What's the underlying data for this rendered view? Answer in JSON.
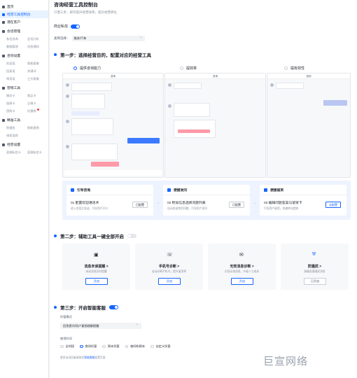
{
  "sidebar": {
    "home": "首页",
    "active_item": "经营工具控制台",
    "customers": "潜在客户",
    "conversation_mgmt": {
      "label": "会话管理",
      "subs": [
        "私信咨询",
        "会话分析",
        "客服管理",
        "消息通知"
      ]
    },
    "consult_settings": {
      "label": "咨询设置",
      "subs": [
        "欢迎语",
        "智能客服",
        "回复语",
        "关键词",
        "常用语",
        "三方客服"
      ]
    },
    "marketing_tools": {
      "label": "营销工具",
      "subs": [
        "服务卡",
        "商品卡",
        "链接卡",
        "企微卡",
        "团购卡",
        "优惠券"
      ]
    },
    "precise_tools": {
      "label": "精准工具",
      "subs": [
        "防骚扰",
        "智能意图",
        "线索追踪"
      ]
    },
    "account": {
      "label": "经营设置",
      "subs": [
        "蓝微私信卡",
        "蓝微私信卡"
      ]
    }
  },
  "header": {
    "title": "咨询经营工具控制台",
    "subtitle": "只需三步，即可提升经营效率，提升经营转化"
  },
  "private_msg": {
    "label": "商业私信",
    "toggle_on": true
  },
  "industry": {
    "label": "类目选择：",
    "value": "服务/汽车"
  },
  "step1": {
    "title": "第一步：选择经营目的，配置对应的经营工具",
    "options": [
      "提供咨询能力",
      "提效率",
      "提有效性"
    ],
    "phone_header": "咨询"
  },
  "flow": {
    "cards": [
      {
        "head": "引导咨询",
        "title": "01 配置欢迎语话术",
        "desc": "进入会话后发送，引导用户开口",
        "btn": "已配置"
      },
      {
        "head": "便捷发问",
        "title": "02 附加信息选择问题列表",
        "desc": "自动发送常用问题，引导用户发问",
        "btn": "已配置"
      },
      {
        "head": "便捷留资",
        "title": "03 编辑问题答案与留资卡",
        "desc": "引导用户留资，快速转化提效",
        "btn": "去配置"
      }
    ]
  },
  "step2": {
    "title": "第二步：辅助工具一键全部开启",
    "toggle_on": false,
    "tools": [
      {
        "icon": "message-icon",
        "title": "消息未读提醒 >",
        "desc": "未读消息及时提醒",
        "btn": "开启"
      },
      {
        "icon": "phone-icon",
        "title": "手机号诊断 >",
        "desc": "自动诊断手机号，提升留资率",
        "btn": "开启"
      },
      {
        "icon": "diagnosis-icon",
        "title": "无效消息诊断 >",
        "desc": "识别无效消息，节省人力成本",
        "btn": "开启"
      },
      {
        "icon": "shield-icon",
        "title": "防骚扰 >",
        "desc": "屏蔽恶意骚扰消息",
        "btn": "已开启"
      }
    ]
  },
  "step3": {
    "title": "第三步：开启智能客服",
    "toggle_on": true,
    "mode_label": "托管模式",
    "mode_value": "回答提问/用户意图理解提醒",
    "time_label": "使用时间",
    "time_options": [
      "全时段",
      "夜间托管",
      "周末托管",
      "夜间和周末",
      "自定义托管"
    ],
    "time_selected": 1,
    "footnote_prefix": "更多自动回复请前往",
    "footnote_link": "智能客服",
    "footnote_suffix": "配置页面"
  },
  "watermark": "巨宣网络",
  "colors": {
    "accent": "#1664ff",
    "panel": "#edf3ff"
  }
}
